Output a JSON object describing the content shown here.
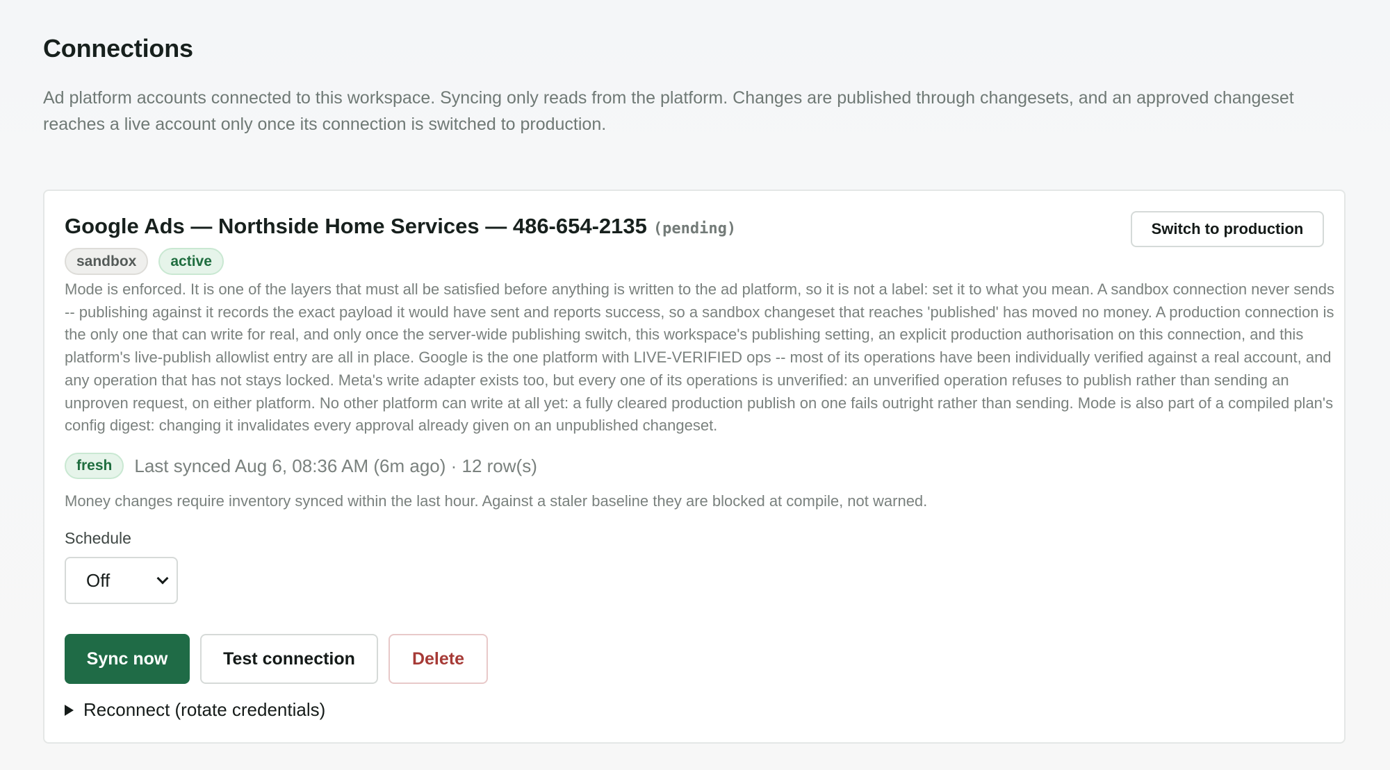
{
  "page": {
    "title": "Connections",
    "description": "Ad platform accounts connected to this workspace. Syncing only reads from the platform. Changes are published through changesets, and an approved changeset reaches a live account only once its connection is switched to production."
  },
  "connection": {
    "title": "Google Ads — Northside Home Services — 486-654-2135",
    "status_tag": "(pending)",
    "switch_button": "Switch to production",
    "badges": [
      "sandbox",
      "active"
    ],
    "mode_description": "Mode is enforced. It is one of the layers that must all be satisfied before anything is written to the ad platform, so it is not a label: set it to what you mean. A sandbox connection never sends -- publishing against it records the exact payload it would have sent and reports success, so a sandbox changeset that reaches 'published' has moved no money. A production connection is the only one that can write for real, and only once the server-wide publishing switch, this workspace's publishing setting, an explicit production authorisation on this connection, and this platform's live-publish allowlist entry are all in place. Google is the one platform with LIVE-VERIFIED ops -- most of its operations have been individually verified against a real account, and any operation that has not stays locked. Meta's write adapter exists too, but every one of its operations is unverified: an unverified operation refuses to publish rather than sending an unproven request, on either platform. No other platform can write at all yet: a fully cleared production publish on one fails outright rather than sending. Mode is also part of a compiled plan's config digest: changing it invalidates every approval already given on an unpublished changeset.",
    "freshness_badge": "fresh",
    "sync_status": "Last synced Aug 6, 08:36 AM (6m ago) · 12 row(s)",
    "money_note": "Money changes require inventory synced within the last hour. Against a staler baseline they are blocked at compile, not warned.",
    "schedule": {
      "label": "Schedule",
      "value": "Off"
    },
    "actions": {
      "sync": "Sync now",
      "test": "Test connection",
      "delete": "Delete"
    },
    "reconnect_label": "Reconnect (rotate credentials)"
  },
  "colors": {
    "primary_green": "#1f6b46",
    "delete_red": "#a63a36",
    "badge_green_bg": "#e6f4ea",
    "badge_gray_bg": "#efefed"
  },
  "icons": {
    "schedule_dropdown": "chevron-down-icon",
    "reconnect_toggle": "disclosure-triangle-icon"
  }
}
